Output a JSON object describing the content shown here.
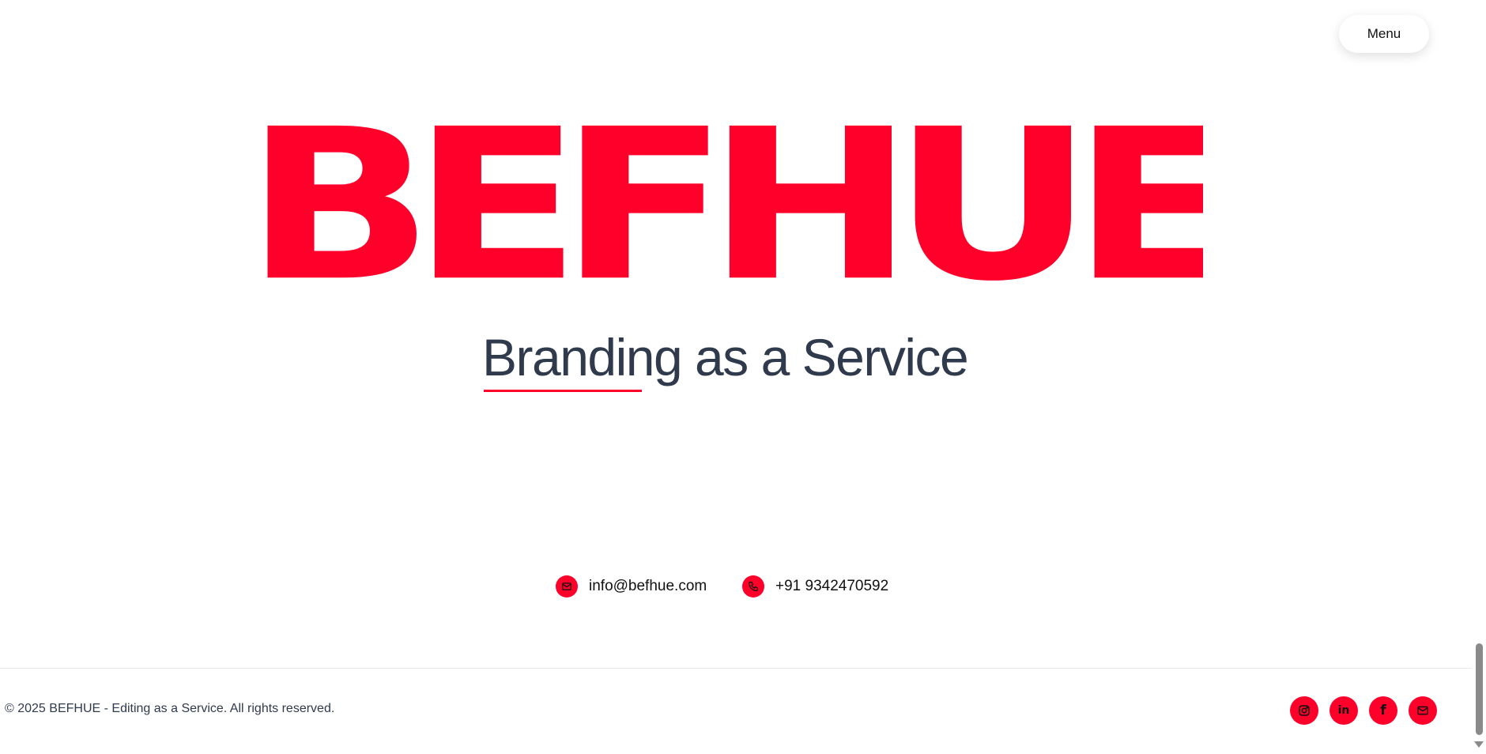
{
  "header": {
    "menu_label": "Menu"
  },
  "hero": {
    "brand_name": "BEFHUE",
    "tagline": "Branding as a Service"
  },
  "contact": {
    "email": "info@befhue.com",
    "phone": "+91 9342470592",
    "email_icon": "mail-icon",
    "phone_icon": "phone-icon"
  },
  "footer": {
    "copyright": "© 2025 BEFHUE - Editing as a Service. All rights reserved.",
    "socials": [
      {
        "icon": "instagram-icon"
      },
      {
        "icon": "linkedin-icon"
      },
      {
        "icon": "facebook-icon"
      },
      {
        "icon": "mail-icon"
      }
    ]
  },
  "colors": {
    "accent": "#ff002b",
    "text_dark": "#303a4d"
  }
}
